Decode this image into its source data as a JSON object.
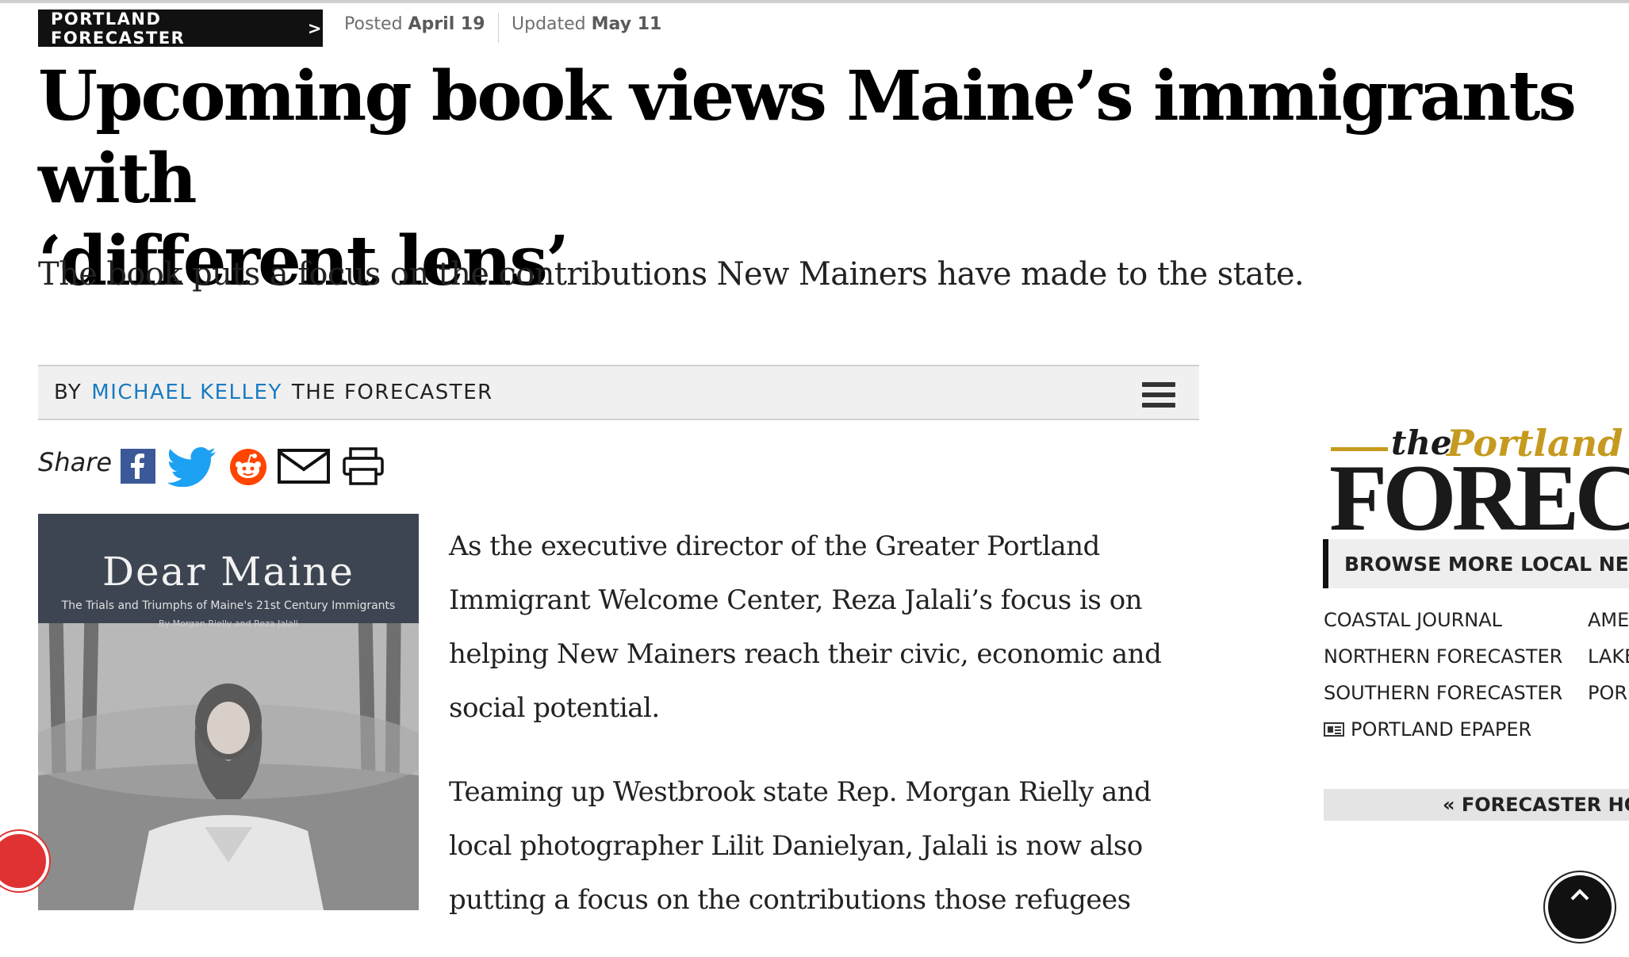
{
  "header": {
    "section_kicker": "PORTLAND FORECASTER",
    "kicker_chevron": ">",
    "posted_label": "Posted",
    "posted_date": "April 19",
    "updated_label": "Updated",
    "updated_date": "May 11"
  },
  "article": {
    "headline_line1": "Upcoming book views Maine’s immigrants with",
    "headline_line2": "‘different lens’",
    "dek": "The book puts a focus on the contributions New Mainers have made to the state.",
    "byline_prefix": "BY",
    "author": "MICHAEL KELLEY",
    "publication": "THE FORECASTER",
    "share_label": "Share",
    "paragraphs": [
      "As the executive director of the Greater Portland Immigrant Welcome Center, Reza Jalali’s focus is on helping New Mainers reach their civic, economic and social potential.",
      "Teaming up Westbrook state Rep. Morgan Rielly and local photographer Lilit Danielyan, Jalali is now also putting a focus on the contributions those refugees"
    ]
  },
  "share_icons": [
    "facebook-icon",
    "twitter-icon",
    "reddit-icon",
    "email-icon",
    "print-icon"
  ],
  "cover": {
    "title": "Dear Maine",
    "subtitle": "The Trials and Triumphs of Maine's 21st Century Immigrants",
    "authors": "By Morgan Rielly and Reza Jalali"
  },
  "sidebar": {
    "logo_the": "the",
    "logo_portland": "Portland",
    "logo_forecaster": "FORECA",
    "browse_label": "BROWSE MORE LOCAL NEW",
    "links_col1": [
      "COASTAL JOURNAL",
      "NORTHERN FORECASTER",
      "SOUTHERN FORECASTER"
    ],
    "epaper_label": "PORTLAND EPAPER",
    "links_col2": [
      "AME",
      "LAKE",
      "POR"
    ],
    "forecaster_home": "« FORECASTER HO"
  },
  "colors": {
    "accent_link": "#1a7bc1",
    "kicker_bg": "#111111",
    "logo_gold": "#c59a1e",
    "notification_red": "#e03232"
  }
}
